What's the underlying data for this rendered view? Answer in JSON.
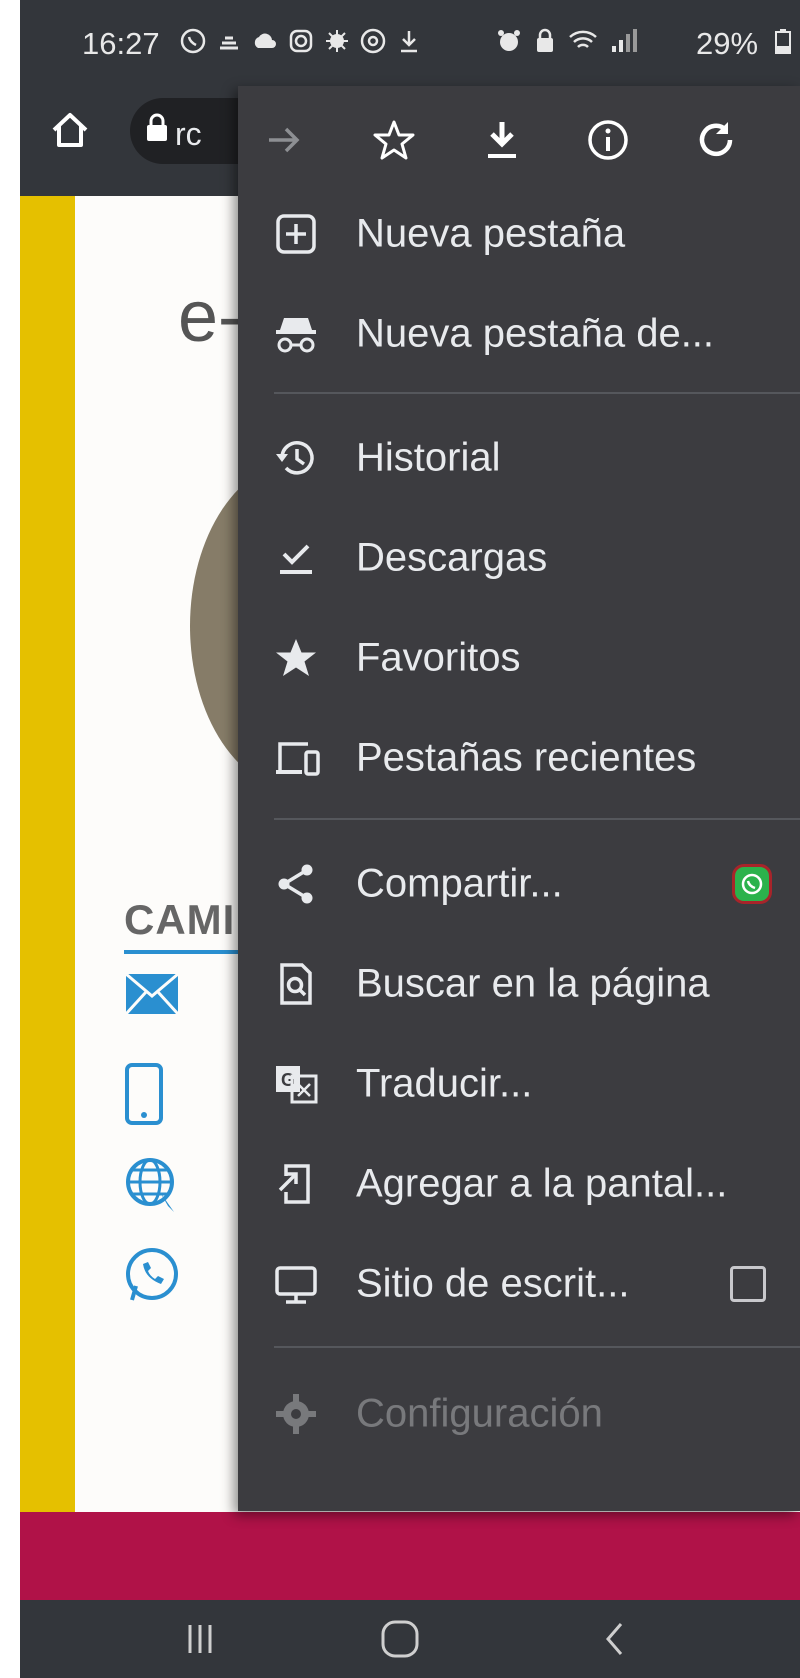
{
  "status_bar": {
    "time": "16:27",
    "battery": "29%"
  },
  "browser": {
    "url_fragment": "rc"
  },
  "page": {
    "heading_fragment": "e-",
    "section_label": "CAMI"
  },
  "menu": {
    "items": [
      {
        "label": "Nueva pestaña",
        "icon": "new-tab-icon"
      },
      {
        "label": "Nueva pestaña de...",
        "icon": "incognito-icon"
      },
      {
        "label": "Historial",
        "icon": "history-icon"
      },
      {
        "label": "Descargas",
        "icon": "downloads-icon"
      },
      {
        "label": "Favoritos",
        "icon": "star-icon"
      },
      {
        "label": "Pestañas recientes",
        "icon": "devices-icon"
      },
      {
        "label": "Compartir...",
        "icon": "share-icon"
      },
      {
        "label": "Buscar en la página",
        "icon": "find-in-page-icon"
      },
      {
        "label": "Traducir...",
        "icon": "translate-icon"
      },
      {
        "label": "Agregar a la pantal...",
        "icon": "add-to-home-icon"
      },
      {
        "label": "Sitio de escrit...",
        "icon": "desktop-icon"
      },
      {
        "label": "Configuración",
        "icon": "settings-icon"
      }
    ]
  },
  "colors": {
    "menu_bg": "#3c3c40",
    "accent_yellow": "#e5c000",
    "footer": "#b01248"
  }
}
